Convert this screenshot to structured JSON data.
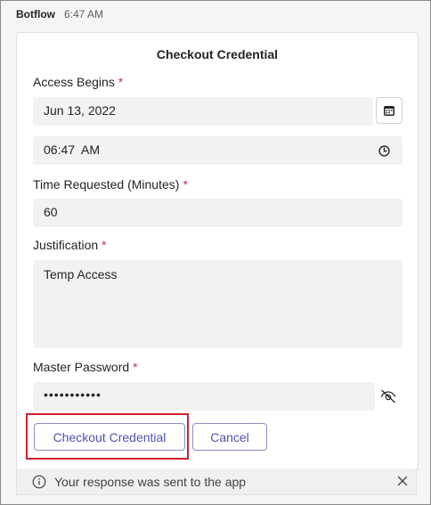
{
  "message": {
    "sender": "Botflow",
    "time": "6:47 AM"
  },
  "card": {
    "title": "Checkout Credential",
    "access_begins": {
      "label": "Access Begins",
      "required_mark": "*",
      "date_value": "Jun 13, 2022",
      "time_value": "06:47  AM",
      "date_icon": "calendar-icon",
      "time_icon": "clock-icon"
    },
    "time_requested": {
      "label": "Time Requested (Minutes)",
      "required_mark": "*",
      "value": "60"
    },
    "justification": {
      "label": "Justification",
      "required_mark": "*",
      "value": "Temp Access"
    },
    "master_password": {
      "label": "Master Password",
      "required_mark": "*",
      "value": "•••••••••••",
      "toggle_icon": "eye-off-icon"
    },
    "actions": {
      "primary_label": "Checkout Credential",
      "secondary_label": "Cancel"
    }
  },
  "status": {
    "text": "Your response was sent to the app",
    "info_icon": "info-icon",
    "close_icon": "close-icon"
  },
  "colors": {
    "accent": "#4f52b2",
    "required": "#c4314b",
    "highlight": "#d21f2b",
    "input_bg": "#f3f2f1"
  }
}
